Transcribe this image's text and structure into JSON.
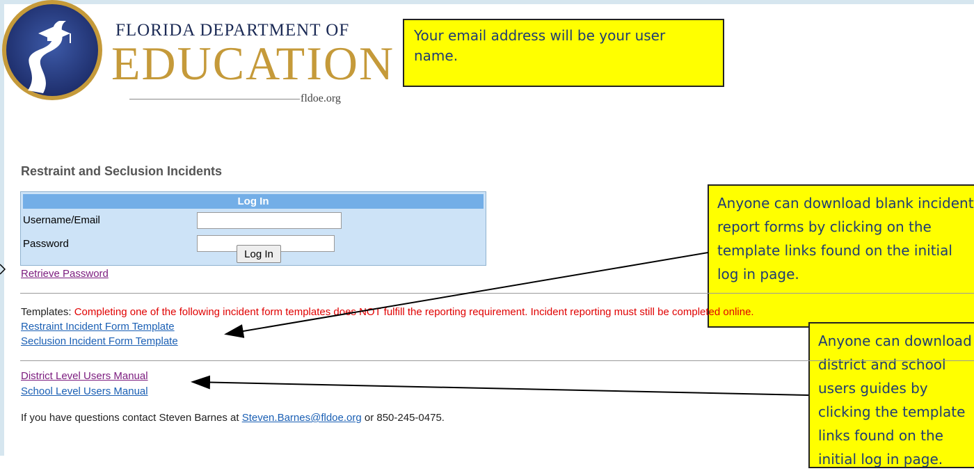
{
  "logo": {
    "line1": "Florida Department of",
    "line2": "EDUCATION",
    "url": "fldoe.org"
  },
  "callouts": {
    "email": "Your email address will be your user name.",
    "templates": "Anyone can download blank incident report forms by clicking on the template links found on the initial log in page.",
    "manuals": "Anyone can download district and school users guides by clicking the template links found on the initial log in page."
  },
  "page_title": "Restraint and Seclusion Incidents",
  "login": {
    "header": "Log In",
    "username_label": "Username/Email",
    "password_label": "Password",
    "username_value": "",
    "password_value": "",
    "button_label": "Log In"
  },
  "retrieve_password": "Retrieve Password",
  "templates": {
    "label": "Templates: ",
    "warning": "Completing one of the following incident form templates does NOT fulfill the reporting requirement. Incident reporting must still be completed online.",
    "restraint": "Restraint Incident Form Template",
    "seclusion": "Seclusion Incident Form Template"
  },
  "manuals": {
    "district": "District Level Users Manual",
    "school": "School Level Users Manual"
  },
  "contact": {
    "prefix": "If you have questions contact Steven Barnes at ",
    "email": "Steven.Barnes@fldoe.org",
    "suffix": " or 850-245-0475."
  },
  "colors": {
    "callout_bg": "#ffff00",
    "callout_text": "#1f3c73",
    "login_header": "#73aee7",
    "login_bg": "#cde3f7",
    "warning": "#e00000",
    "link_visited": "#7b1b7e",
    "link": "#1a5fb4"
  }
}
